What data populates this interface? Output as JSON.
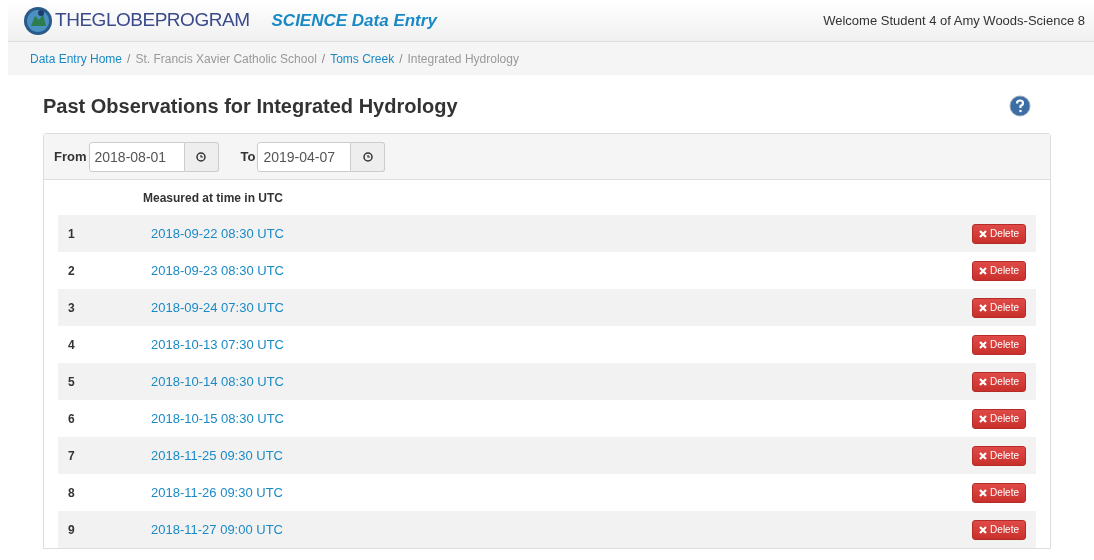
{
  "header": {
    "logo_text": "THEGLOBEPROGRAM",
    "app_title": "SCIENCE Data Entry",
    "welcome": "Welcome Student 4 of Amy Woods-Science 8"
  },
  "breadcrumb": [
    {
      "label": "Data Entry Home",
      "link": true
    },
    {
      "separator": "/",
      "label": "St. Francis Xavier Catholic School",
      "link": false
    },
    {
      "separator": "/",
      "label": "Toms Creek",
      "link": true
    },
    {
      "separator": "/",
      "label": "Integrated Hydrology",
      "link": false
    }
  ],
  "page_title": "Past Observations for Integrated Hydrology",
  "filter": {
    "from_label": "From",
    "from_value": "2018-08-01",
    "to_label": "To",
    "to_value": "2019-04-07"
  },
  "table": {
    "columns": [
      "Measured at time in UTC"
    ],
    "rows": [
      {
        "index": "1",
        "time": "2018-09-22 08:30 UTC",
        "action": "Delete"
      },
      {
        "index": "2",
        "time": "2018-09-23 08:30 UTC",
        "action": "Delete"
      },
      {
        "index": "3",
        "time": "2018-09-24 07:30 UTC",
        "action": "Delete"
      },
      {
        "index": "4",
        "time": "2018-10-13 07:30 UTC",
        "action": "Delete"
      },
      {
        "index": "5",
        "time": "2018-10-14 08:30 UTC",
        "action": "Delete"
      },
      {
        "index": "6",
        "time": "2018-10-15 08:30 UTC",
        "action": "Delete"
      },
      {
        "index": "7",
        "time": "2018-11-25 09:30 UTC",
        "action": "Delete"
      },
      {
        "index": "8",
        "time": "2018-11-26 09:30 UTC",
        "action": "Delete"
      },
      {
        "index": "9",
        "time": "2018-11-27 09:00 UTC",
        "action": "Delete"
      }
    ]
  }
}
